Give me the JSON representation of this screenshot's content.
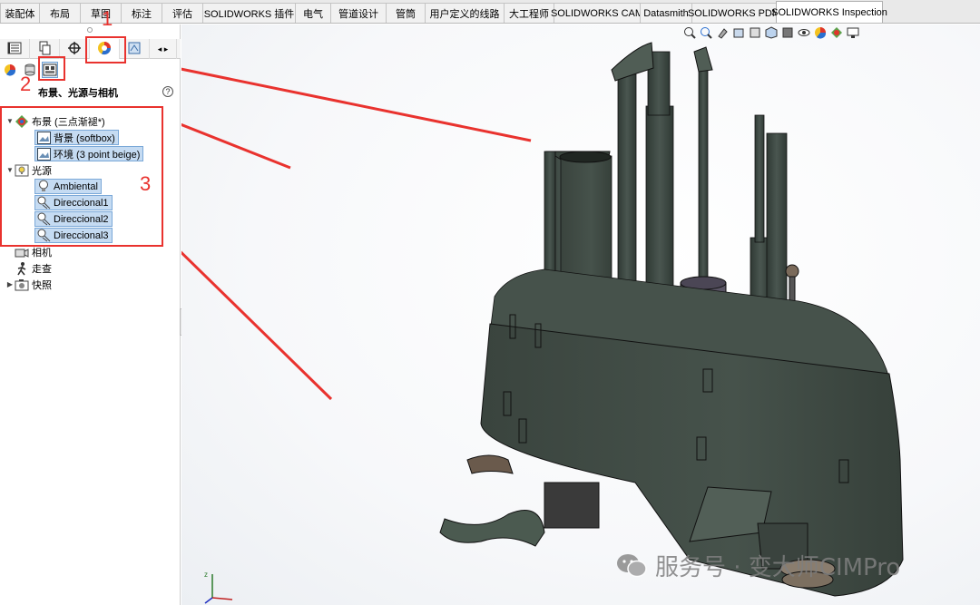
{
  "tabs": [
    {
      "label": "装配体",
      "width": 44
    },
    {
      "label": "布局",
      "width": 46
    },
    {
      "label": "草图",
      "width": 46
    },
    {
      "label": "标注",
      "width": 46
    },
    {
      "label": "评估",
      "width": 46
    },
    {
      "label": "SOLIDWORKS 插件",
      "width": 103
    },
    {
      "label": "电气",
      "width": 40
    },
    {
      "label": "管道设计",
      "width": 62
    },
    {
      "label": "管筒",
      "width": 44
    },
    {
      "label": "用户定义的线路",
      "width": 88
    },
    {
      "label": "大工程师",
      "width": 56
    },
    {
      "label": "SOLIDWORKS CAM",
      "width": 96
    },
    {
      "label": "Datasmith",
      "width": 58
    },
    {
      "label": "SOLIDWORKS PDM",
      "width": 94
    },
    {
      "label": "SOLIDWORKS Inspection",
      "width": 118
    }
  ],
  "panel": {
    "title": "布景、光源与相机",
    "help": "?"
  },
  "tree": {
    "scene": {
      "label": "布景 (三点渐褪*)"
    },
    "background": {
      "label": "背景 (softbox)"
    },
    "environment": {
      "label": "环境 (3 point beige)"
    },
    "lights": {
      "label": "光源"
    },
    "ambient": {
      "label": "Ambiental"
    },
    "dir1": {
      "label": "Direccional1"
    },
    "dir2": {
      "label": "Direccional2"
    },
    "dir3": {
      "label": "Direccional3"
    },
    "camera": {
      "label": "相机"
    },
    "walkthrough": {
      "label": "走查"
    },
    "snapshot": {
      "label": "快照"
    }
  },
  "annotations": {
    "n1": "1",
    "n2": "2",
    "n3": "3"
  },
  "watermark": {
    "text": "服务号 · 变大师CIMPro"
  },
  "colors": {
    "annotation_red": "#e9322e",
    "model_green": "#3f4a43",
    "selection_blue": "#c5dbf2"
  }
}
